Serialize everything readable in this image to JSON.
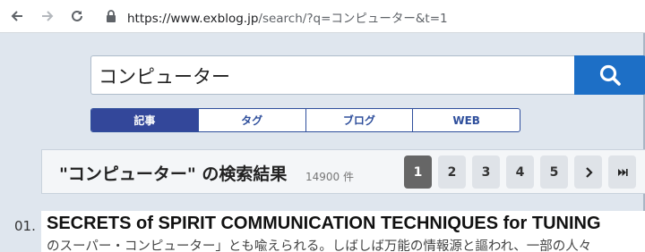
{
  "browser": {
    "url_host": "https://www.exblog.jp",
    "url_path": "/search/?q=コンピューター&t=1"
  },
  "search": {
    "value": "コンピューター",
    "placeholder": ""
  },
  "tabs": [
    {
      "label": "記事",
      "active": true
    },
    {
      "label": "タグ",
      "active": false
    },
    {
      "label": "ブログ",
      "active": false
    },
    {
      "label": "WEB",
      "active": false
    }
  ],
  "results_header": {
    "title": "\"コンピューター\" の検索結果",
    "count": "14900 件"
  },
  "pagination": {
    "pages": [
      "1",
      "2",
      "3",
      "4",
      "5"
    ],
    "current": "1",
    "next_icon": "chevron-right-icon",
    "last_icon": "skip-to-end-icon"
  },
  "results": [
    {
      "index": "01.",
      "title": "SECRETS of SPIRIT COMMUNICATION TECHNIQUES for TUNING",
      "snippet": "のスーパー・コンピューター」とも喩えられる。しばしば万能の情報源と謳われ、一部の人々"
    }
  ],
  "colors": {
    "accent_blue": "#1d6fc6",
    "tab_navy": "#33479a",
    "page_bg": "#dfe6ee"
  }
}
